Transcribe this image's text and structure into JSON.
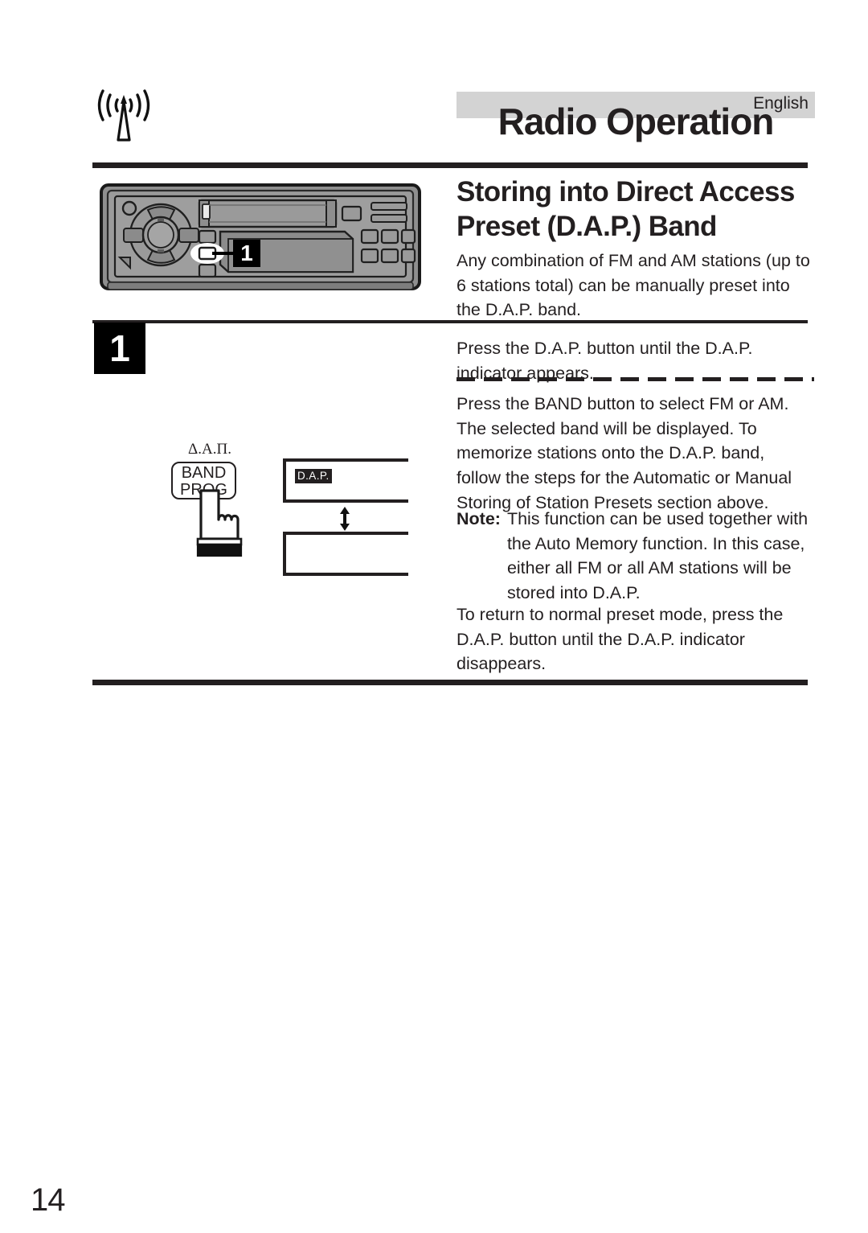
{
  "page": {
    "language_label": "English",
    "title": "Radio Operation",
    "number": "14"
  },
  "section": {
    "heading": "Storing into Direct Access Preset (D.A.P.) Band",
    "intro": "Any combination of FM and AM stations (up to 6 stations total) can be manually preset into the D.A.P. band."
  },
  "steps": {
    "badge_1": "1",
    "step1_text": "Press the D.A.P. button until the D.A.P. indicator appears.",
    "step2_text": "Press the BAND button to select FM or AM. The selected band will be displayed. To memorize stations onto the D.A.P. band, follow the steps for the Automatic or Manual Storing of Station Presets section above."
  },
  "note": {
    "label": "Note:",
    "text": "This function can be used together with the Auto Memory function. In this case, either all FM or all AM stations will be stored into D.A.P."
  },
  "closing": {
    "text": "To return to normal preset mode, press the D.A.P. button until the D.A.P. indicator disappears."
  },
  "diagram": {
    "callout_1": "1",
    "greek_label": "Δ.Α.Π.",
    "key_line1": "BAND",
    "key_line2": "PROG",
    "lcd_indicator": "D.A.P.",
    "lcd_empty": ""
  },
  "icons": {
    "antenna": "antenna-icon",
    "hand_press": "pressing-hand-icon",
    "updown_arrow": "up-down-arrow-icon"
  },
  "colors": {
    "ink": "#231f20",
    "banner_gray": "#d3d3d3",
    "faceplate_gray": "#8c8c8c",
    "badge_black": "#000000"
  }
}
